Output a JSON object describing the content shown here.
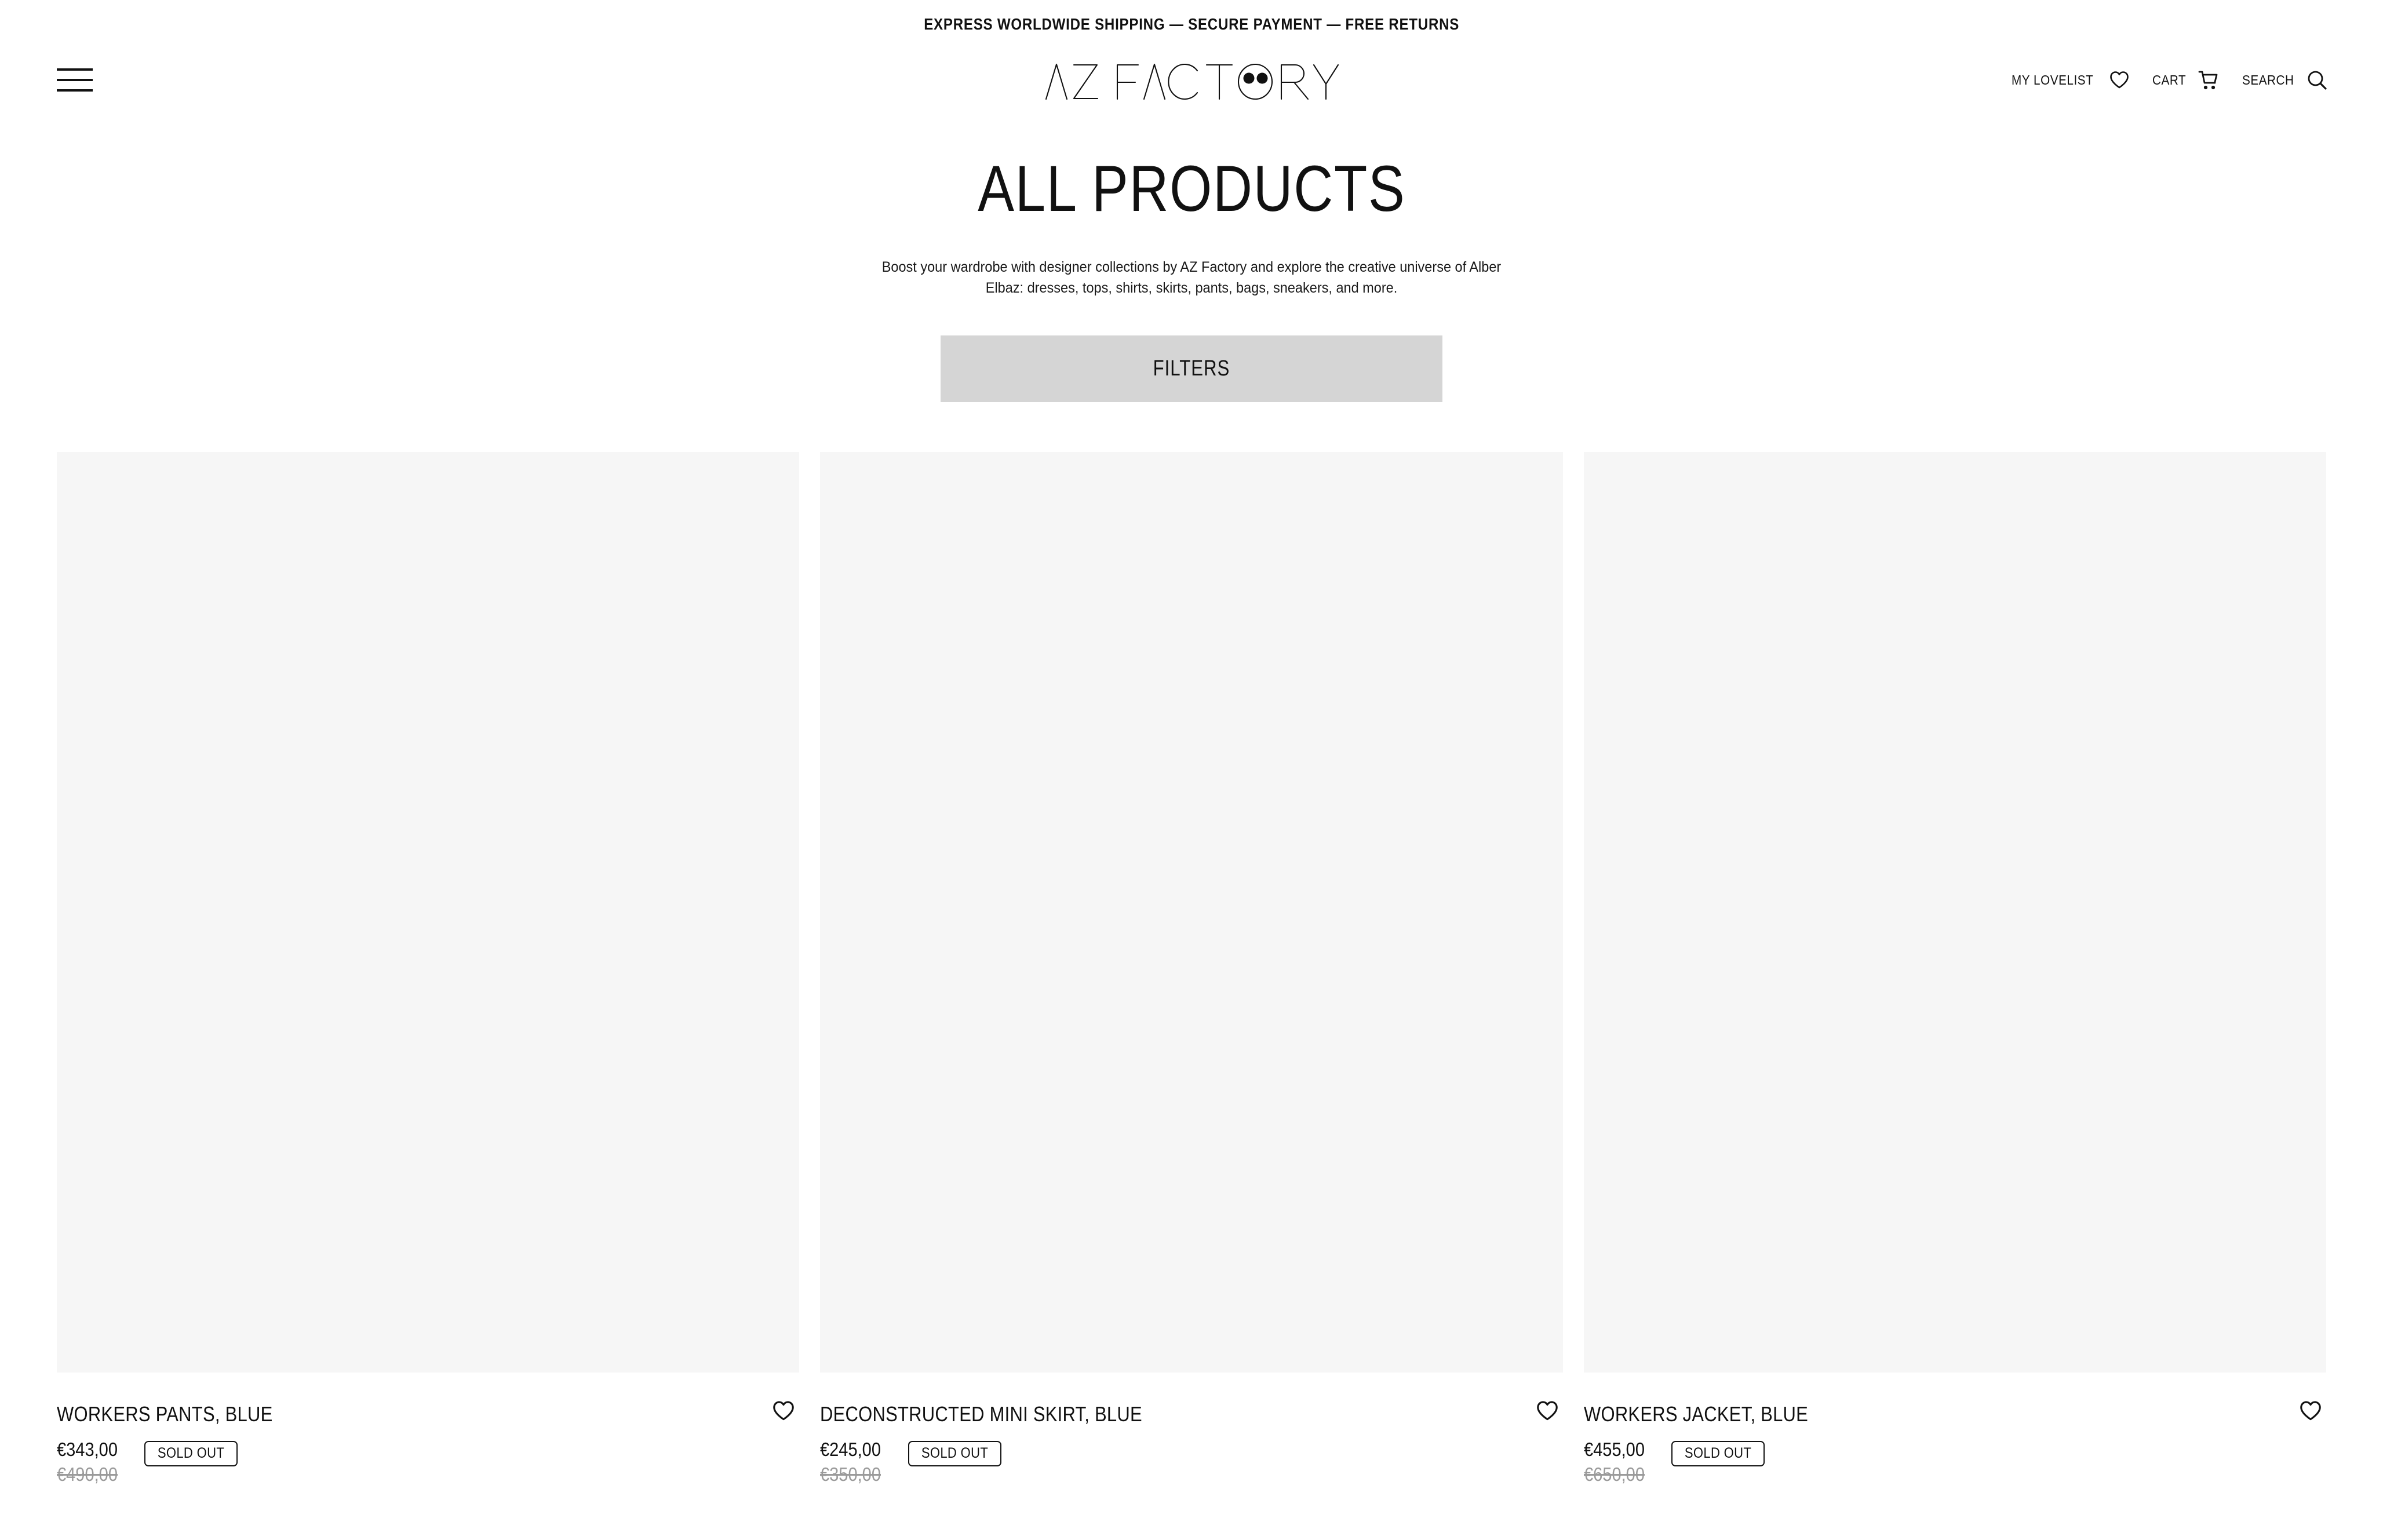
{
  "announcement": {
    "text": "EXPRESS WORLDWIDE SHIPPING — SECURE PAYMENT — FREE RETURNS"
  },
  "header": {
    "menu_icon": "hamburger-menu-icon",
    "logo_text": "AZ FACTORY",
    "logo_part_1": "AZ FACT",
    "logo_part_2": "RY",
    "actions": [
      {
        "label": "MY LOVELIST",
        "icon": "heart-icon"
      },
      {
        "label": "CART",
        "icon": "shopping-cart-icon"
      },
      {
        "label": "SEARCH",
        "icon": "magnifier-icon"
      }
    ]
  },
  "page": {
    "title": "ALL PRODUCTS",
    "description": "Boost your wardrobe with designer collections by AZ Factory and explore the creative universe of Alber Elbaz: dresses, tops, shirts, skirts, pants, bags, sneakers, and more."
  },
  "filters": {
    "label": "FILTERS",
    "background_color": "#d5d5d5"
  },
  "products": [
    {
      "title": "WORKERS PANTS, BLUE",
      "price": "€343,00",
      "compare_at_price": "€490,00",
      "status_badge": "SOLD OUT",
      "wishlist_icon": "heart-icon",
      "image_placeholder_color": "#f6f6f6"
    },
    {
      "title": "DECONSTRUCTED MINI SKIRT, BLUE",
      "price": "€245,00",
      "compare_at_price": "€350,00",
      "status_badge": "SOLD OUT",
      "wishlist_icon": "heart-icon",
      "image_placeholder_color": "#f6f6f6"
    },
    {
      "title": "WORKERS JACKET, BLUE",
      "price": "€455,00",
      "compare_at_price": "€650,00",
      "status_badge": "SOLD OUT",
      "wishlist_icon": "heart-icon",
      "image_placeholder_color": "#f6f6f6"
    }
  ],
  "colors": {
    "text": "#111111",
    "muted_text": "#9a9a9a",
    "background": "#ffffff",
    "placeholder": "#f6f6f6",
    "filter_button": "#d5d5d5"
  }
}
